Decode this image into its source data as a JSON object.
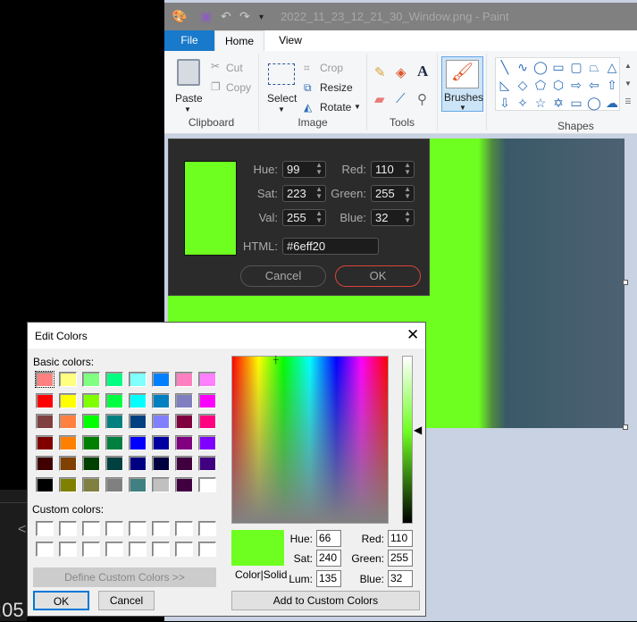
{
  "background_app": {
    "time_fragment": ":05",
    "back_chevron": "<"
  },
  "paint": {
    "title": "2022_11_23_12_21_30_Window.png - Paint",
    "quick_access": [
      "paint-app-icon",
      "save-icon",
      "undo-icon",
      "redo-icon",
      "customize-dropdown-icon"
    ],
    "tabs": [
      {
        "label": "File"
      },
      {
        "label": "Home"
      },
      {
        "label": "View"
      }
    ],
    "ribbon": {
      "clipboard": {
        "label": "Clipboard",
        "paste": "Paste",
        "cut": "Cut",
        "copy": "Copy"
      },
      "image": {
        "label": "Image",
        "select": "Select",
        "crop": "Crop",
        "resize": "Resize",
        "rotate": "Rotate"
      },
      "tools": {
        "label": "Tools"
      },
      "brushes": {
        "label": "Brushes"
      },
      "shapes": {
        "label": "Shapes",
        "glyphs": [
          "╲",
          "∿",
          "◯",
          "▭",
          "▢",
          "⏢",
          "△",
          "◺",
          "◇",
          "⬠",
          "⬡",
          "⇨",
          "⇦",
          "⇧",
          "⇩",
          "✧",
          "☆",
          "✡",
          "▭",
          "◯",
          "☁"
        ]
      }
    },
    "canvas": {
      "green": "#6eff20",
      "slate": "#4d6272"
    }
  },
  "picker": {
    "hue_label": "Hue:",
    "hue": "99",
    "sat_label": "Sat:",
    "sat": "223",
    "val_label": "Val:",
    "val": "255",
    "red_label": "Red:",
    "red": "110",
    "green_label": "Green:",
    "green": "255",
    "blue_label": "Blue:",
    "blue": "32",
    "html_label": "HTML:",
    "html": "#6eff20",
    "cancel": "Cancel",
    "ok": "OK",
    "color": "#6eff20",
    "ok_border": "#d9453a"
  },
  "edit_colors": {
    "title": "Edit Colors",
    "basic_label": "Basic colors:",
    "basic_colors": [
      "#ff8080",
      "#ffff80",
      "#80ff80",
      "#00ff80",
      "#80ffff",
      "#0080ff",
      "#ff80c0",
      "#ff80ff",
      "#ff0000",
      "#ffff00",
      "#80ff00",
      "#00ff40",
      "#00ffff",
      "#0080c0",
      "#8080c0",
      "#ff00ff",
      "#804040",
      "#ff8040",
      "#00ff00",
      "#008080",
      "#004080",
      "#8080ff",
      "#800040",
      "#ff0080",
      "#800000",
      "#ff8000",
      "#008000",
      "#008040",
      "#0000ff",
      "#0000a0",
      "#800080",
      "#8000ff",
      "#400000",
      "#804000",
      "#004000",
      "#004040",
      "#000080",
      "#000040",
      "#400040",
      "#400080",
      "#000000",
      "#808000",
      "#808040",
      "#808080",
      "#408080",
      "#c0c0c0",
      "#400040",
      "#ffffff"
    ],
    "custom_label": "Custom colors:",
    "custom_colors": [
      "#ffffff",
      "#ffffff",
      "#ffffff",
      "#ffffff",
      "#ffffff",
      "#ffffff",
      "#ffffff",
      "#ffffff",
      "#ffffff",
      "#ffffff",
      "#ffffff",
      "#ffffff",
      "#ffffff",
      "#ffffff",
      "#ffffff",
      "#ffffff"
    ],
    "define_custom": "Define Custom Colors >>",
    "ok": "OK",
    "cancel": "Cancel",
    "color_solid": "Color|Solid",
    "hue_label": "Hue:",
    "hue": "66",
    "sat_label": "Sat:",
    "sat": "240",
    "lum_label": "Lum:",
    "lum": "135",
    "red_label": "Red:",
    "red": "110",
    "green_label": "Green:",
    "green": "255",
    "blue_label": "Blue:",
    "blue": "32",
    "add_custom": "Add to Custom Colors",
    "selected_color": "#6eff20"
  }
}
